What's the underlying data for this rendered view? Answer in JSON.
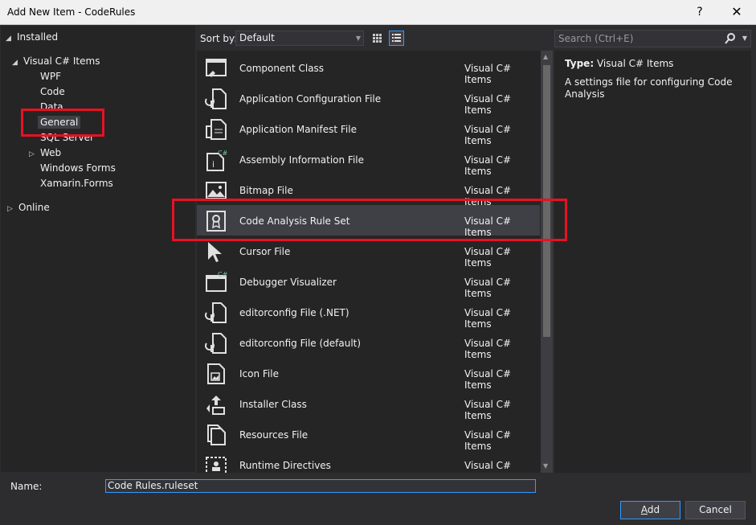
{
  "window": {
    "title": "Add New Item - CodeRules",
    "help": "?",
    "close": "✕"
  },
  "tree": {
    "installed": "Installed",
    "visual_csharp": "Visual C# Items",
    "children": [
      "WPF",
      "Code",
      "Data",
      "General",
      "SQL Server",
      "Web",
      "Windows Forms",
      "Xamarin.Forms"
    ],
    "online": "Online"
  },
  "toolbar": {
    "sort_label": "Sort by:",
    "sort_value": "Default",
    "search_placeholder": "Search (Ctrl+E)"
  },
  "items": [
    {
      "name": "Component Class",
      "category": "Visual C# Items",
      "icon": "component-class-icon"
    },
    {
      "name": "Application Configuration File",
      "category": "Visual C# Items",
      "icon": "config-file-icon"
    },
    {
      "name": "Application Manifest File",
      "category": "Visual C# Items",
      "icon": "manifest-file-icon"
    },
    {
      "name": "Assembly Information File",
      "category": "Visual C# Items",
      "icon": "assembly-info-icon"
    },
    {
      "name": "Bitmap File",
      "category": "Visual C# Items",
      "icon": "bitmap-icon"
    },
    {
      "name": "Code Analysis Rule Set",
      "category": "Visual C# Items",
      "icon": "ruleset-icon"
    },
    {
      "name": "Cursor File",
      "category": "Visual C# Items",
      "icon": "cursor-icon"
    },
    {
      "name": "Debugger Visualizer",
      "category": "Visual C# Items",
      "icon": "debugger-visualizer-icon"
    },
    {
      "name": "editorconfig File (.NET)",
      "category": "Visual C# Items",
      "icon": "editorconfig-icon"
    },
    {
      "name": "editorconfig File (default)",
      "category": "Visual C# Items",
      "icon": "editorconfig-icon"
    },
    {
      "name": "Icon File",
      "category": "Visual C# Items",
      "icon": "icon-file-icon"
    },
    {
      "name": "Installer Class",
      "category": "Visual C# Items",
      "icon": "installer-class-icon"
    },
    {
      "name": "Resources File",
      "category": "Visual C# Items",
      "icon": "resources-file-icon"
    },
    {
      "name": "Runtime Directives",
      "category": "Visual C# Items",
      "icon": "runtime-directives-icon"
    }
  ],
  "detail": {
    "type_label": "Type:",
    "type_value": "Visual C# Items",
    "description": "A settings file for configuring Code Analysis"
  },
  "bottom": {
    "name_label": "Name:",
    "name_value": "Code Rules.ruleset",
    "add_label_accel": "A",
    "add_label_rest": "dd",
    "cancel_label": "Cancel"
  },
  "colors": {
    "background": "#2d2d30",
    "pane": "#252526",
    "selection": "#3f3f46",
    "accent": "#3399ff",
    "highlight_box": "#e81123"
  }
}
